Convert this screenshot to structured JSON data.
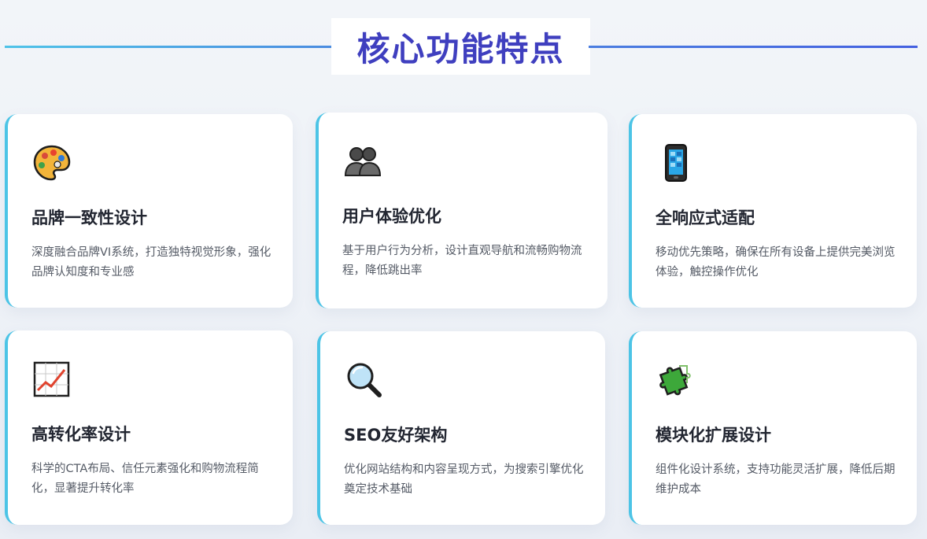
{
  "section": {
    "title": "核心功能特点"
  },
  "features": [
    {
      "icon": "palette-icon",
      "title": "品牌一致性设计",
      "description": "深度融合品牌VI系统，打造独特视觉形象，强化品牌认知度和专业感"
    },
    {
      "icon": "people-icon",
      "title": "用户体验优化",
      "description": "基于用户行为分析，设计直观导航和流畅购物流程，降低跳出率"
    },
    {
      "icon": "mobile-phone-icon",
      "title": "全响应式适配",
      "description": "移动优先策略，确保在所有设备上提供完美浏览体验，触控操作优化"
    },
    {
      "icon": "chart-increasing-icon",
      "title": "高转化率设计",
      "description": "科学的CTA布局、信任元素强化和购物流程简化，显著提升转化率"
    },
    {
      "icon": "magnifying-glass-icon",
      "title": "SEO友好架构",
      "description": "优化网站结构和内容呈现方式，为搜索引擎优化奠定技术基础"
    },
    {
      "icon": "puzzle-piece-icon",
      "title": "模块化扩展设计",
      "description": "组件化设计系统，支持功能灵活扩展，降低后期维护成本"
    }
  ],
  "colors": {
    "title": "#3f3fbf",
    "accent": "#4cc4e6",
    "card_title": "#222631",
    "card_desc": "#555b66"
  }
}
